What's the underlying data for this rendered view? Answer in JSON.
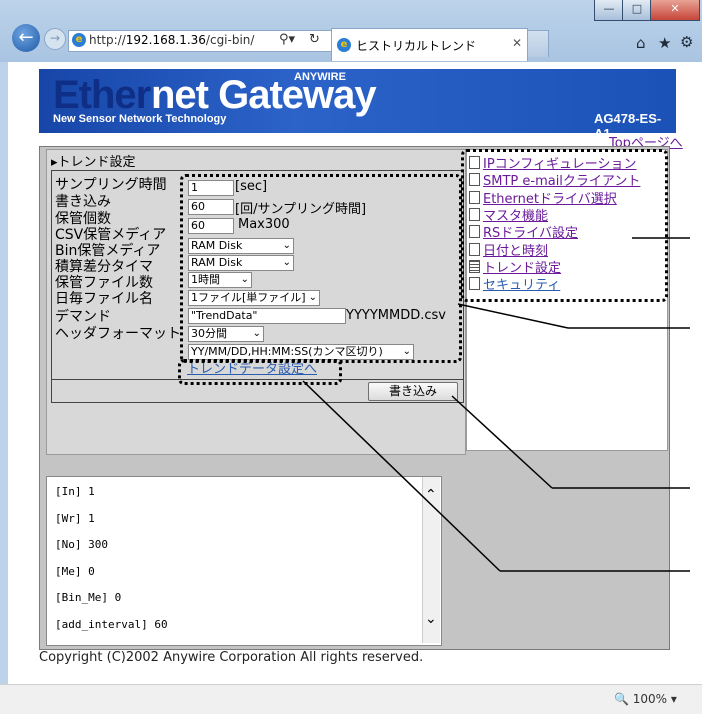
{
  "browser": {
    "url_host": "192.168.1.36",
    "url_prefix": "http://",
    "url_suffix": "/cgi-bin/",
    "tab_title": "ヒストリカルトレンド",
    "zoom": "100%"
  },
  "header": {
    "logo_ether": "Ether",
    "logo_net": "net Gateway",
    "logo_anywire": "ANYWIRE",
    "logo_subtitle": "New Sensor Network Technology",
    "model": "AG478-ES-A1",
    "top_link": "Topページへ"
  },
  "settings": {
    "section_title": "▸トレンド設定",
    "fields": {
      "sampling_label": "サンプリング時間",
      "sampling_value": "1",
      "sampling_unit": "[sec]",
      "write_label": "書き込み",
      "write_value": "60",
      "write_unit": "[回/サンプリング時間]",
      "keep_label": "保管個数",
      "keep_value": "60",
      "keep_unit": "Max300",
      "csv_label": "CSV保管メディア",
      "csv_value": "RAM Disk",
      "bin_label": "Bin保管メディア",
      "bin_value": "RAM Disk",
      "diff_label": "積算差分タイマ",
      "diff_value": "1時間",
      "files_label": "保管ファイル数",
      "files_value": "1ファイル[単ファイル]",
      "daily_label": "日毎ファイル名",
      "daily_value": "\"TrendData\"",
      "daily_suffix": "YYYYMMDD.csv",
      "demand_label": "デマンド",
      "demand_value": "30分間",
      "header_label": "ヘッダフォーマット",
      "header_value": "YY/MM/DD,HH:MM:SS(カンマ区切り)"
    },
    "trend_data_link": "トレンドデータ設定へ",
    "write_button": "書き込み"
  },
  "nav": {
    "items": [
      {
        "label": "IPコンフィギュレーション",
        "color": "#6a1a9a"
      },
      {
        "label": "SMTP e-mailクライアント",
        "color": "#6a1a9a"
      },
      {
        "label": "Ethernetドライバ選択",
        "color": "#6a1a9a"
      },
      {
        "label": "マスタ機能",
        "color": "#6a1a9a"
      },
      {
        "label": "RSドライバ設定",
        "color": "#6a1a9a"
      },
      {
        "label": "日付と時刻",
        "color": "#6a1a9a"
      },
      {
        "label": "トレンド設定",
        "color": "#6a1a9a"
      },
      {
        "label": "セキュリティ",
        "color": "#2a5db0"
      }
    ]
  },
  "log": {
    "lines": [
      "[In] 1",
      "[Wr] 1",
      "[No] 300",
      "[Me] 0",
      "[Bin_Me] 0",
      "[add_interval] 60"
    ]
  },
  "footer": {
    "copyright": "Copyright (C)2002 Anywire Corporation All rights reserved."
  }
}
